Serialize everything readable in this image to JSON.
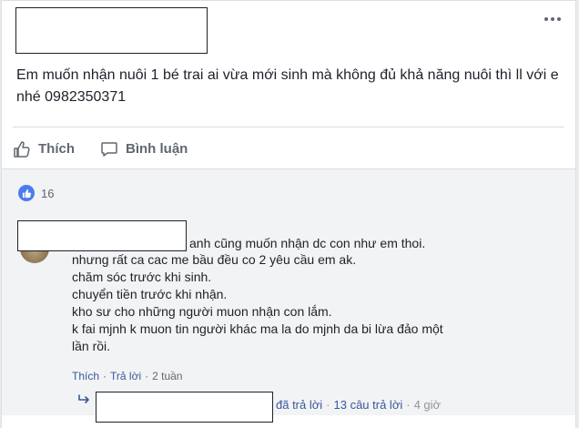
{
  "post": {
    "text": "Em muốn nhận nuôi 1 bé trai ai vừa mới sinh mà không đủ khả năng nuôi thì ll với e nhé 0982350371",
    "actions": {
      "like_label": "Thích",
      "comment_label": "Bình luận"
    },
    "reactions": {
      "count": "16"
    }
  },
  "comment": {
    "first_line": "anh cũng muốn nhận dc con như em thoi.",
    "lines": [
      "nhưng rất ca cac me bầu đều co 2 yêu cầu em ak.",
      "chăm sóc trước khi sinh.",
      "chuyển tiền trước khi nhận.",
      "kho sư cho những người muon nhận con lắm.",
      "k fai mjnh k muon tin người khác ma la do mjnh da bi lừa đảo một",
      "lần rồi."
    ],
    "meta": {
      "like": "Thích",
      "reply": "Trả lời",
      "time": "2 tuần"
    },
    "reply_summary": {
      "replied": "đã trả lời",
      "count": "13 câu trả lời",
      "time": "4 giờ"
    }
  },
  "colors": {
    "accent": "#385898",
    "like_blue": "#4a7ced",
    "muted": "#606770"
  }
}
